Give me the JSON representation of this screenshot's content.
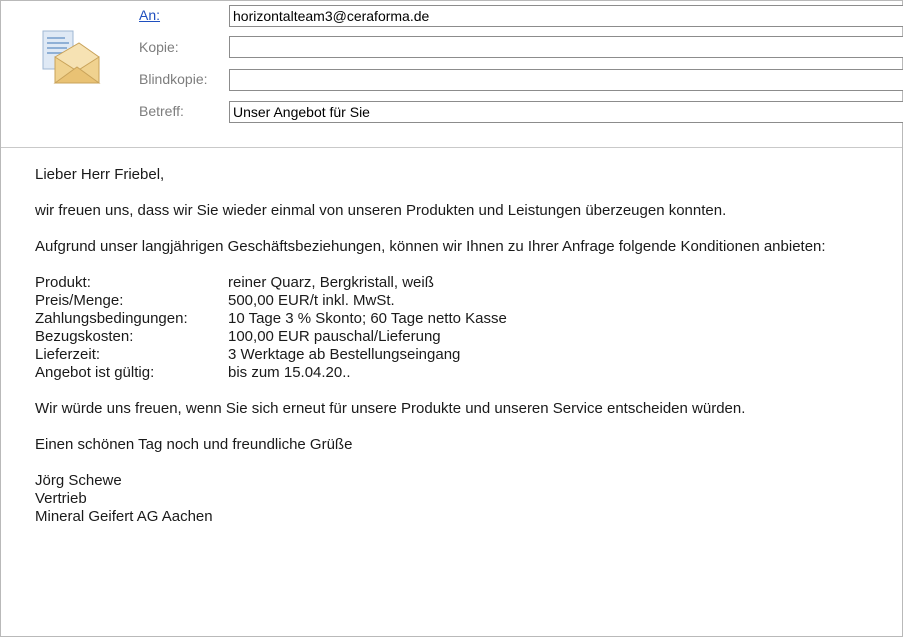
{
  "header": {
    "to_label": "An:",
    "to_value": "horizontalteam3@ceraforma.de",
    "cc_label": "Kopie:",
    "cc_value": "",
    "bcc_label": "Blindkopie:",
    "bcc_value": "",
    "subject_label": "Betreff:",
    "subject_value": "Unser Angebot für Sie",
    "icon": "envelope-icon"
  },
  "body": {
    "greeting": "Lieber Herr Friebel,",
    "para1": "wir freuen uns, dass wir Sie wieder einmal von unseren Produkten und Leistungen überzeugen konnten.",
    "para2": "Aufgrund unser langjährigen Geschäftsbeziehungen, können wir Ihnen zu Ihrer Anfrage folgende Konditionen anbieten:",
    "specs": [
      {
        "label": "Produkt:",
        "value": "reiner Quarz, Bergkristall, weiß"
      },
      {
        "label": "Preis/Menge:",
        "value": "500,00 EUR/t inkl. MwSt."
      },
      {
        "label": "Zahlungsbedingungen:",
        "value": "10 Tage 3 % Skonto; 60 Tage netto Kasse"
      },
      {
        "label": "Bezugskosten:",
        "value": "100,00 EUR pauschal/Lieferung"
      },
      {
        "label": "Lieferzeit:",
        "value": "3 Werktage ab Bestellungseingang"
      },
      {
        "label": "Angebot ist gültig:",
        "value": "bis zum 15.04.20.."
      }
    ],
    "para3": "Wir würde uns freuen, wenn Sie sich erneut für unsere Produkte und unseren Service entscheiden würden.",
    "closing": "Einen schönen Tag noch und freundliche Grüße",
    "signature_name": "Jörg Schewe",
    "signature_dept": "Vertrieb",
    "signature_company": "Mineral Geifert AG Aachen"
  }
}
